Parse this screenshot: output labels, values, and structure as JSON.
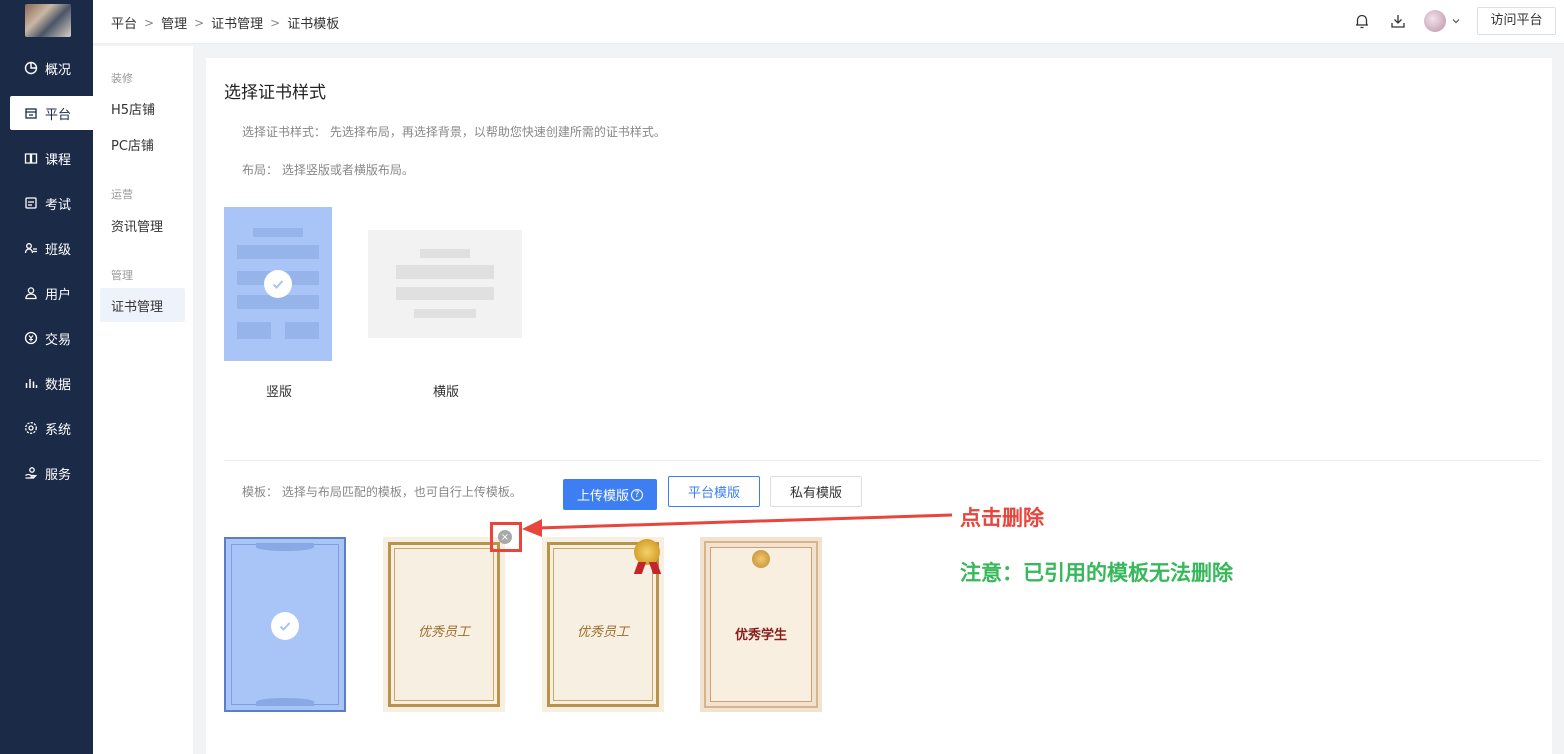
{
  "nav": {
    "items": [
      {
        "label": "概况",
        "icon": "pie-chart-icon"
      },
      {
        "label": "平台",
        "icon": "store-icon"
      },
      {
        "label": "课程",
        "icon": "book-icon"
      },
      {
        "label": "考试",
        "icon": "exam-icon"
      },
      {
        "label": "班级",
        "icon": "class-icon"
      },
      {
        "label": "用户",
        "icon": "user-icon"
      },
      {
        "label": "交易",
        "icon": "transaction-icon"
      },
      {
        "label": "数据",
        "icon": "bar-chart-icon"
      },
      {
        "label": "系统",
        "icon": "gear-icon"
      },
      {
        "label": "服务",
        "icon": "service-icon"
      }
    ],
    "active": "平台"
  },
  "sub": {
    "groups": [
      {
        "title": "装修",
        "links": [
          "H5店铺",
          "PC店铺"
        ]
      },
      {
        "title": "运营",
        "links": [
          "资讯管理"
        ]
      },
      {
        "title": "管理",
        "links": [
          "证书管理"
        ]
      }
    ],
    "active": "证书管理"
  },
  "header": {
    "breadcrumb": [
      "平台",
      "管理",
      "证书管理",
      "证书模板"
    ],
    "visit_button": "访问平台"
  },
  "main": {
    "title": "选择证书样式",
    "style_desc": "选择证书样式：  先选择布局，再选择背景，以帮助您快速创建所需的证书样式。",
    "layout_desc": "布局：  选择竖版或者横版布局。",
    "layouts": [
      {
        "label": "竖版",
        "selected": true
      },
      {
        "label": "横版",
        "selected": false
      }
    ],
    "template_desc": "模板：  选择与布局匹配的模板，也可自行上传模板。",
    "buttons": {
      "upload": "上传模版",
      "platform": "平台模版",
      "private": "私有模版"
    },
    "certificates": [
      {
        "text": "",
        "selected": true
      },
      {
        "text": "优秀员工",
        "selected": false
      },
      {
        "text": "优秀员工",
        "selected": false
      },
      {
        "text": "优秀学生",
        "selected": false
      }
    ]
  },
  "annotation": {
    "delete_hint": "点击删除",
    "note": "注意：已引用的模板无法删除"
  },
  "colors": {
    "nav_bg": "#1b2a47",
    "primary": "#3d7ff2",
    "selected_blue": "#a9c4f7",
    "annotation_red": "#e8453c",
    "annotation_green": "#37b85a"
  }
}
